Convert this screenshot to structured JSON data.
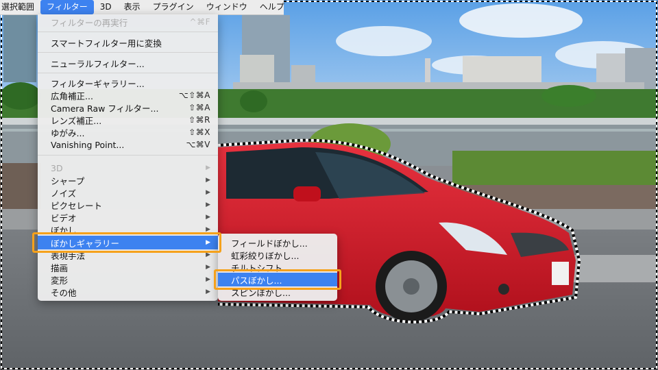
{
  "menubar": {
    "items": [
      "選択範囲",
      "フィルター",
      "3D",
      "表示",
      "プラグイン",
      "ウィンドウ",
      "ヘルプ"
    ]
  },
  "filter_menu": {
    "items": [
      {
        "label": "フィルターの再実行",
        "shortcut": "^⌘F",
        "disabled": true
      },
      {
        "label": "スマートフィルター用に変換"
      },
      {
        "label": "ニューラルフィルター..."
      },
      {
        "label": "フィルターギャラリー..."
      },
      {
        "label": "広角補正...",
        "shortcut": "⌥⇧⌘A"
      },
      {
        "label": "Camera Raw フィルター...",
        "shortcut": "⇧⌘A"
      },
      {
        "label": "レンズ補正...",
        "shortcut": "⇧⌘R"
      },
      {
        "label": "ゆがみ...",
        "shortcut": "⇧⌘X"
      },
      {
        "label": "Vanishing Point...",
        "shortcut": "⌥⌘V"
      },
      {
        "label": "3D",
        "submenu": true,
        "disabled": true
      },
      {
        "label": "シャープ",
        "submenu": true
      },
      {
        "label": "ノイズ",
        "submenu": true
      },
      {
        "label": "ピクセレート",
        "submenu": true
      },
      {
        "label": "ビデオ",
        "submenu": true
      },
      {
        "label": "ぼかし",
        "submenu": true
      },
      {
        "label": "ぼかしギャラリー",
        "submenu": true,
        "selected": true
      },
      {
        "label": "表現手法",
        "submenu": true
      },
      {
        "label": "描画",
        "submenu": true
      },
      {
        "label": "変形",
        "submenu": true
      },
      {
        "label": "その他",
        "submenu": true
      }
    ]
  },
  "blur_gallery_submenu": {
    "items": [
      {
        "label": "フィールドぼかし..."
      },
      {
        "label": "虹彩絞りぼかし..."
      },
      {
        "label": "チルトシフト..."
      },
      {
        "label": "パスぼかし...",
        "selected": true
      },
      {
        "label": "スピンぼかし..."
      }
    ]
  },
  "colors": {
    "accent": "#3d82f0",
    "highlight_box": "#f5a11b",
    "car_body": "#d41a2a"
  }
}
